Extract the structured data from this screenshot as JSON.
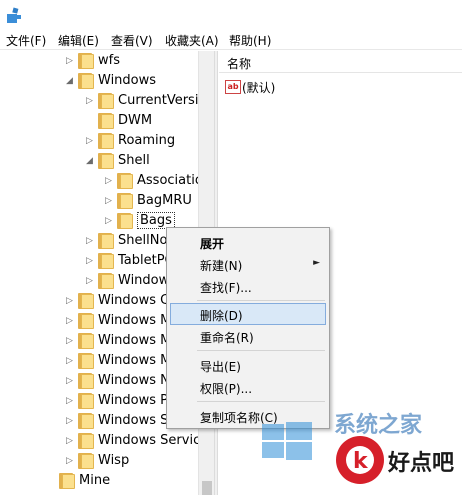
{
  "menubar": {
    "items": [
      "文件(F)",
      "编辑(E)",
      "查看(V)",
      "收藏夹(A)",
      "帮助(H)"
    ]
  },
  "tree": {
    "rows": [
      {
        "label": "wfs",
        "arrow": "▷"
      },
      {
        "label": "Windows",
        "arrow": "◢"
      },
      {
        "label": "CurrentVersio",
        "arrow": "▷"
      },
      {
        "label": "DWM",
        "arrow": ""
      },
      {
        "label": "Roaming",
        "arrow": "▷"
      },
      {
        "label": "Shell",
        "arrow": "◢"
      },
      {
        "label": "Associatio",
        "arrow": "▷"
      },
      {
        "label": "BagMRU",
        "arrow": "▷"
      },
      {
        "label": "Bags",
        "arrow": "▷"
      },
      {
        "label": "ShellNo",
        "arrow": "▷"
      },
      {
        "label": "TabletPC",
        "arrow": "▷"
      },
      {
        "label": "Window",
        "arrow": "▷"
      },
      {
        "label": "Windows C",
        "arrow": "▷"
      },
      {
        "label": "Windows M",
        "arrow": "▷"
      },
      {
        "label": "Windows M",
        "arrow": "▷"
      },
      {
        "label": "Windows M",
        "arrow": "▷"
      },
      {
        "label": "Windows N",
        "arrow": "▷"
      },
      {
        "label": "Windows P",
        "arrow": "▷"
      },
      {
        "label": "Windows S",
        "arrow": "▷"
      },
      {
        "label": "Windows Service",
        "arrow": "▷"
      },
      {
        "label": "Wisp",
        "arrow": "▷"
      },
      {
        "label": "Mine",
        "arrow": ""
      }
    ]
  },
  "right_pane": {
    "column_header": "名称",
    "value_icon": "ab",
    "value_name": "(默认)"
  },
  "context_menu": {
    "items": [
      "展开",
      "新建(N)",
      "查找(F)...",
      "删除(D)",
      "重命名(R)",
      "导出(E)",
      "权限(P)...",
      "复制项名称(C)"
    ],
    "submenu_arrow": "►",
    "highlighted": "删除(D)"
  },
  "watermark": {
    "text1": "系统之家",
    "text2": "好点吧",
    "logo_letter": "k"
  },
  "colors": {
    "folder": "#fbe08e",
    "highlight": "#d9e8f7",
    "logo_red": "#d6202a"
  }
}
